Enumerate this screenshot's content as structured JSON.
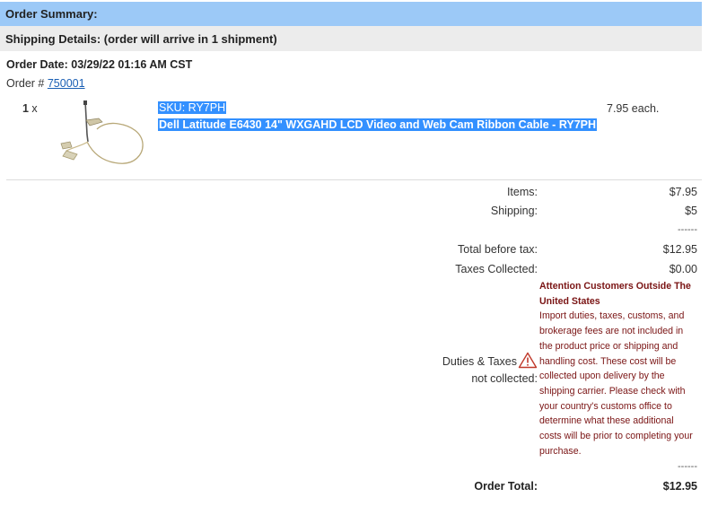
{
  "header": {
    "summary_title": "Order Summary:",
    "shipping_details": "Shipping Details: (order will arrive in 1 shipment)"
  },
  "order": {
    "date": "Order Date: 03/29/22 01:16 AM CST",
    "number_label": "Order # ",
    "number": "750001"
  },
  "item": {
    "qty": "1",
    "qty_suffix": " x",
    "image_icon": "ribbon-cable-image",
    "sku": "SKU: RY7PH",
    "name": "Dell Latitude E6430 14\" WXGAHD LCD Video and Web Cam Ribbon Cable - RY7PH",
    "price_each": "7.95 each."
  },
  "totals": {
    "items_label": "Items:",
    "items_value": "$7.95",
    "shipping_label": "Shipping:",
    "shipping_value": "$5",
    "separator": "------",
    "before_tax_label": "Total before tax:",
    "before_tax_value": "$12.95",
    "taxes_label": "Taxes Collected:",
    "taxes_value": "$0.00",
    "duties_label_1": "Duties & Taxes",
    "duties_label_2": "not collected:",
    "separator_2": "------",
    "order_total_label": "Order Total:",
    "order_total_value": "$12.95"
  },
  "notice": {
    "title": "Attention Customers Outside The United States",
    "body": "Import duties, taxes, customs, and brokerage fees are not included in the product price or shipping and handling cost. These cost will be collected upon delivery by the shipping carrier. Please check with your country's customs office to determine what these additional costs will be prior to completing your purchase."
  },
  "colors": {
    "summary_bar": "#9cc9f7",
    "shipping_bar": "#ececec",
    "selection": "#3390ff",
    "notice_text": "#7a1414",
    "link": "#1a5fb4",
    "warning": "#c0392b"
  }
}
